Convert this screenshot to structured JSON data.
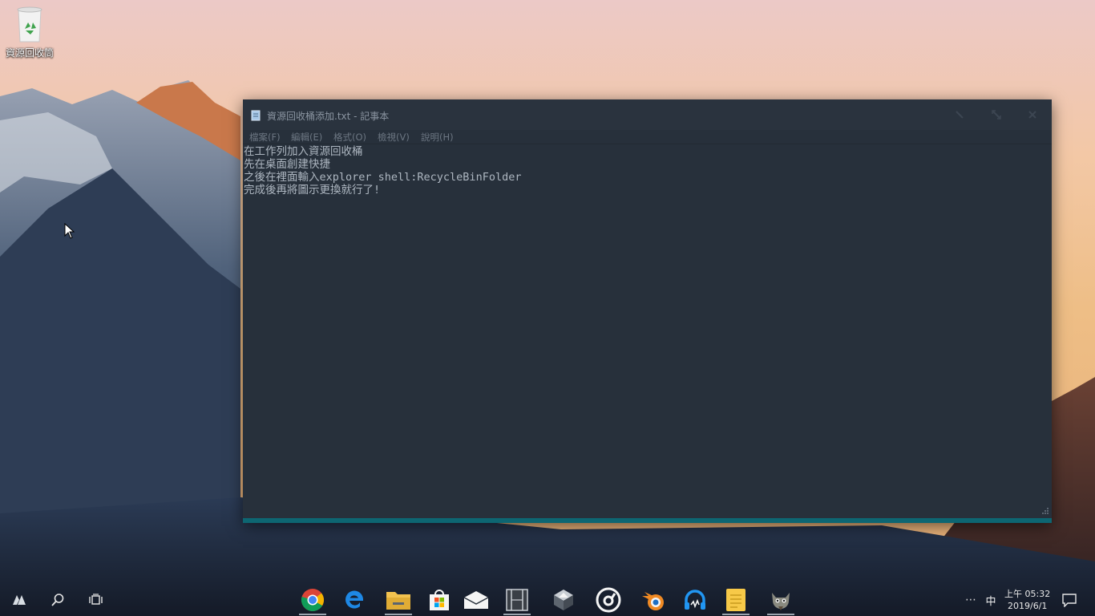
{
  "desktop": {
    "icons": [
      {
        "label": "資源回收筒",
        "icon": "recycle-bin-icon"
      }
    ]
  },
  "window": {
    "title": "資源回收桶添加.txt - 記事本",
    "menu": [
      "檔案(F)",
      "編輯(E)",
      "格式(O)",
      "檢視(V)",
      "說明(H)"
    ],
    "content_lines": [
      "在工作列加入資源回收桶",
      "先在桌面創建快捷",
      "之後在裡面輸入explorer shell:RecycleBinFolder",
      "完成後再將圖示更換就行了!"
    ]
  },
  "taskbar": {
    "left_icons": [
      "start-icon",
      "search-icon",
      "task-view-icon"
    ],
    "apps": [
      {
        "name": "chrome-icon",
        "active": true
      },
      {
        "name": "edge-icon",
        "active": false
      },
      {
        "name": "file-explorer-icon",
        "active": true
      },
      {
        "name": "store-icon",
        "active": false
      },
      {
        "name": "mail-icon",
        "active": false
      },
      {
        "name": "video-editor-icon",
        "active": true
      },
      {
        "name": "package-icon",
        "active": false
      },
      {
        "name": "music-player-icon",
        "active": false
      },
      {
        "name": "blender-icon",
        "active": false
      },
      {
        "name": "audio-app-icon",
        "active": false
      },
      {
        "name": "sticky-notes-icon",
        "active": true
      },
      {
        "name": "gimp-icon",
        "active": true
      }
    ],
    "tray": {
      "overflow": "⋯",
      "ime": "中",
      "time": "上午 05:32",
      "date": "2019/6/1"
    }
  },
  "colors": {
    "window_bg": "#27303b",
    "accent": "#0d6672",
    "text": "#adb6c0"
  }
}
